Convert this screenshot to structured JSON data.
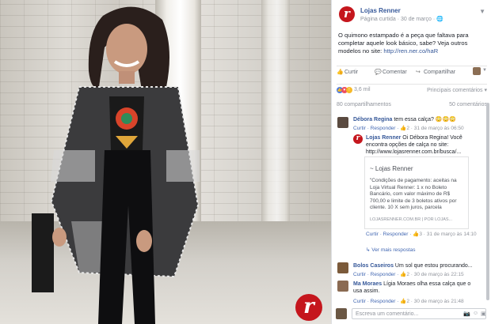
{
  "post": {
    "page_name": "Lojas Renner",
    "meta": "Página curtida · 30 de março · ",
    "text": "O quimono estampado é a peça que faltava para completar aquele look básico, sabe? Veja outros modelos no site: ",
    "link": "http://ren.ner.co/haR"
  },
  "actions": {
    "like": "Curtir",
    "comment": "Comentar",
    "share": "Compartilhar"
  },
  "reactions": {
    "count": "3,6 mil",
    "sort": "Principais comentários ▾"
  },
  "counts": {
    "shares": "80 compartilhamentos",
    "comments": "50 comentários"
  },
  "comments": [
    {
      "name": "Débora Regina",
      "text": " tem essa calça?",
      "emoji": "😳😳😳",
      "meta": "Curtir · Responder · ",
      "likes": "2",
      "time": " · 31 de março às 06:50"
    },
    {
      "name": "Lojas Renner",
      "text": " Oi Débora Regina! Você encontra opções de calça no site: http://www.lojasrenner.com.br/busca/...",
      "meta": "Curtir · Responder · ",
      "likes": "3",
      "time": " · 31 de março às 14:10"
    },
    {
      "name": "Bolos Caseiros",
      "text": " Um sol que estou procurando...",
      "meta": "Curtir · Responder · ",
      "likes": "2",
      "time": " · 30 de março às 22:15"
    },
    {
      "name": "Ma Moraes",
      "text": " Lígia Moraes olha essa calça que o usa assim.",
      "meta": "Curtir · Responder · ",
      "likes": "2",
      "time": " · 30 de março às 21:48"
    }
  ],
  "link_card": {
    "title": "~ Lojas Renner",
    "desc": "\"Condições de pagamento: aceitas na Loja Virtual Renner: 1 x no Boleto Bancário, com valor máximo de R$ 700,00 e limite de 3 boletos ativos por cliente. 10 X sem juros, parcela",
    "url": "LOJASRENNER.COM.BR | POR LOJAS..."
  },
  "more_replies": "Ver mais respostas",
  "write": {
    "placeholder": "Escreva um comentário..."
  },
  "logo": {
    "letter": "r"
  },
  "colors": {
    "brand": "#c5161d",
    "link": "#365899",
    "muted": "#90949c"
  },
  "icons": [
    "like-icon",
    "comment-icon",
    "share-icon",
    "camera-icon",
    "emoji-icon",
    "gif-icon"
  ]
}
